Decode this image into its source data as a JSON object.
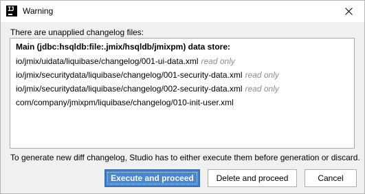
{
  "window": {
    "title": "Warning",
    "app_icon_text": "IJ"
  },
  "message_top": "There are unapplied changelog files:",
  "list": {
    "header": "Main (jdbc:hsqldb:file:.jmix/hsqldb/jmixpm) data store:",
    "items": [
      {
        "path": "io/jmix/uidata/liquibase/changelog/001-ui-data.xml",
        "tag": "read only"
      },
      {
        "path": "io/jmix/securitydata/liquibase/changelog/001-security-data.xml",
        "tag": "read only"
      },
      {
        "path": "io/jmix/securitydata/liquibase/changelog/002-security-data.xml",
        "tag": "read only"
      },
      {
        "path": "com/company/jmixpm/liquibase/changelog/010-init-user.xml",
        "tag": ""
      }
    ]
  },
  "message_bottom": "To generate new diff changelog, Studio has to either execute them before generation or discard.",
  "buttons": {
    "execute": "Execute and proceed",
    "delete": "Delete and proceed",
    "cancel": "Cancel"
  },
  "colors": {
    "primary_button": "#4a87d3",
    "read_only_text": "#8c8c8c"
  },
  "icons": {
    "app": "intellij-idea-icon",
    "close": "close-icon"
  }
}
